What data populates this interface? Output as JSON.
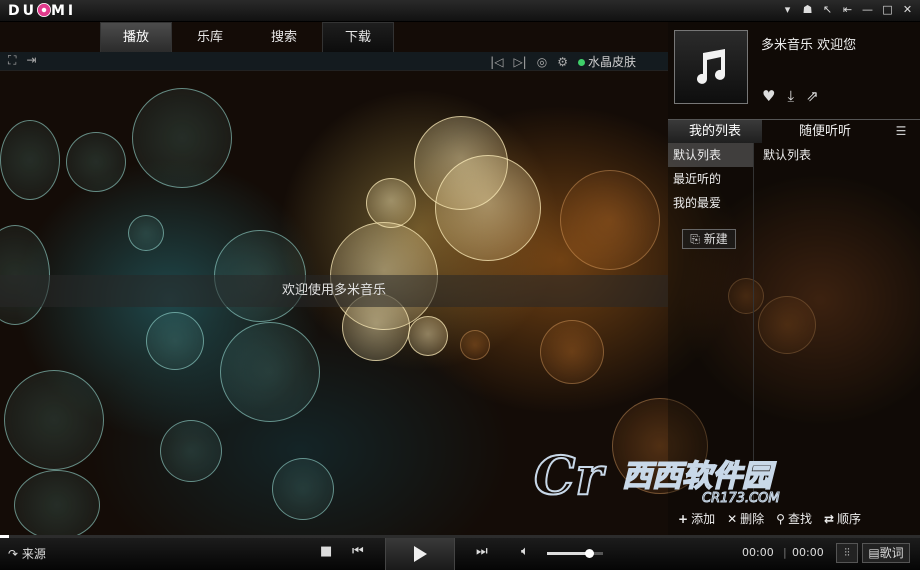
{
  "app": {
    "logo": "DU",
    "logo_tail": "MI"
  },
  "window_controls": [
    "▾",
    "☗",
    "↖",
    "⇤",
    "—",
    "□",
    "✕"
  ],
  "tabs": [
    {
      "label": "播放",
      "active": true
    },
    {
      "label": "乐库",
      "active": false
    },
    {
      "label": "搜索",
      "active": false
    },
    {
      "label": "下载",
      "active": false
    }
  ],
  "toolbar": {
    "skin_label": "水晶皮肤"
  },
  "player": {
    "welcome_message": "欢迎使用多米音乐"
  },
  "user": {
    "welcome": "多米音乐  欢迎您"
  },
  "playlist_panel": {
    "tabs": [
      {
        "label": "我的列表",
        "active": true
      },
      {
        "label": "随便听听",
        "active": false
      }
    ],
    "lists": [
      {
        "label": "默认列表",
        "active": true
      },
      {
        "label": "最近听的",
        "active": false
      },
      {
        "label": "我的最爱",
        "active": false
      }
    ],
    "new_button": "新建",
    "current_list_title": "默认列表",
    "footer": {
      "add": "添加",
      "delete": "删除",
      "find": "查找",
      "order": "顺序"
    }
  },
  "watermark": {
    "text": "西西软件园",
    "sub": "CR173.COM"
  },
  "bottom": {
    "source_label": "来源",
    "elapsed": "00:00",
    "total": "00:00",
    "lyric_label": "歌词",
    "volume_level": 0.75,
    "progress_level": 0.01
  },
  "icons": {
    "cover": "music-note-icon",
    "heart": "heart-icon",
    "download": "download-icon",
    "share": "share-icon",
    "stop": "stop-icon",
    "prev": "previous-icon",
    "play": "play-icon",
    "next": "next-icon",
    "volume": "volume-icon"
  }
}
